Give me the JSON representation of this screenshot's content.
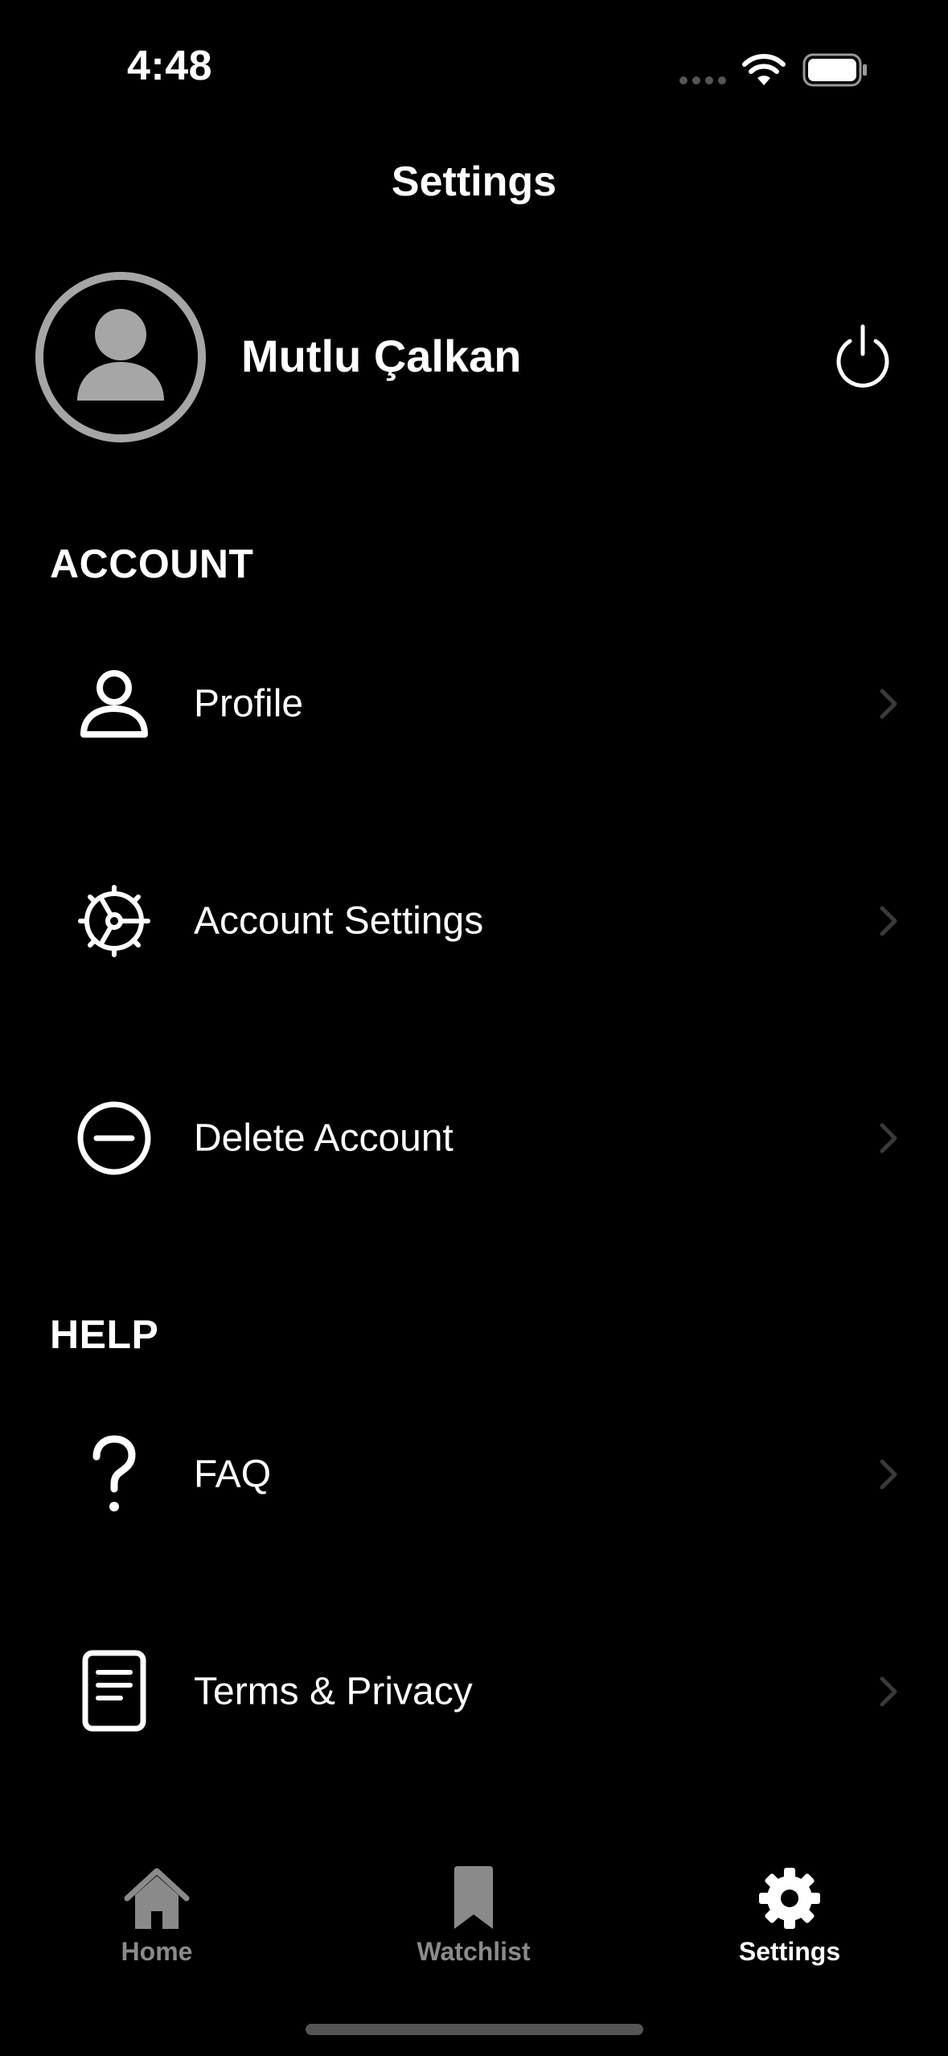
{
  "status_bar": {
    "time": "4:48",
    "wifi_icon": "wifi-icon",
    "battery_icon": "battery-icon"
  },
  "nav": {
    "title": "Settings"
  },
  "profile": {
    "avatar_icon": "avatar-icon",
    "name": "Mutlu Çalkan",
    "logout_icon": "power-icon"
  },
  "sections": {
    "account": {
      "title": "ACCOUNT",
      "items": [
        {
          "label": "Profile",
          "icon": "person-icon"
        },
        {
          "label": "Account Settings",
          "icon": "gear-outline-icon"
        },
        {
          "label": "Delete Account",
          "icon": "minus-circle-icon"
        }
      ]
    },
    "help": {
      "title": "HELP",
      "items": [
        {
          "label": "FAQ",
          "icon": "question-icon"
        },
        {
          "label": "Terms & Privacy",
          "icon": "document-icon"
        }
      ]
    }
  },
  "tab_bar": {
    "tabs": [
      {
        "label": "Home",
        "icon": "home-icon",
        "active": false
      },
      {
        "label": "Watchlist",
        "icon": "bookmark-icon",
        "active": false
      },
      {
        "label": "Settings",
        "icon": "gear-icon",
        "active": true
      }
    ]
  },
  "colors": {
    "background": "#000000",
    "text": "#ffffff",
    "inactive_tab": "#8a8a8a",
    "avatar_gray": "#a6a6a6",
    "chevron": "#3a3a3a"
  }
}
